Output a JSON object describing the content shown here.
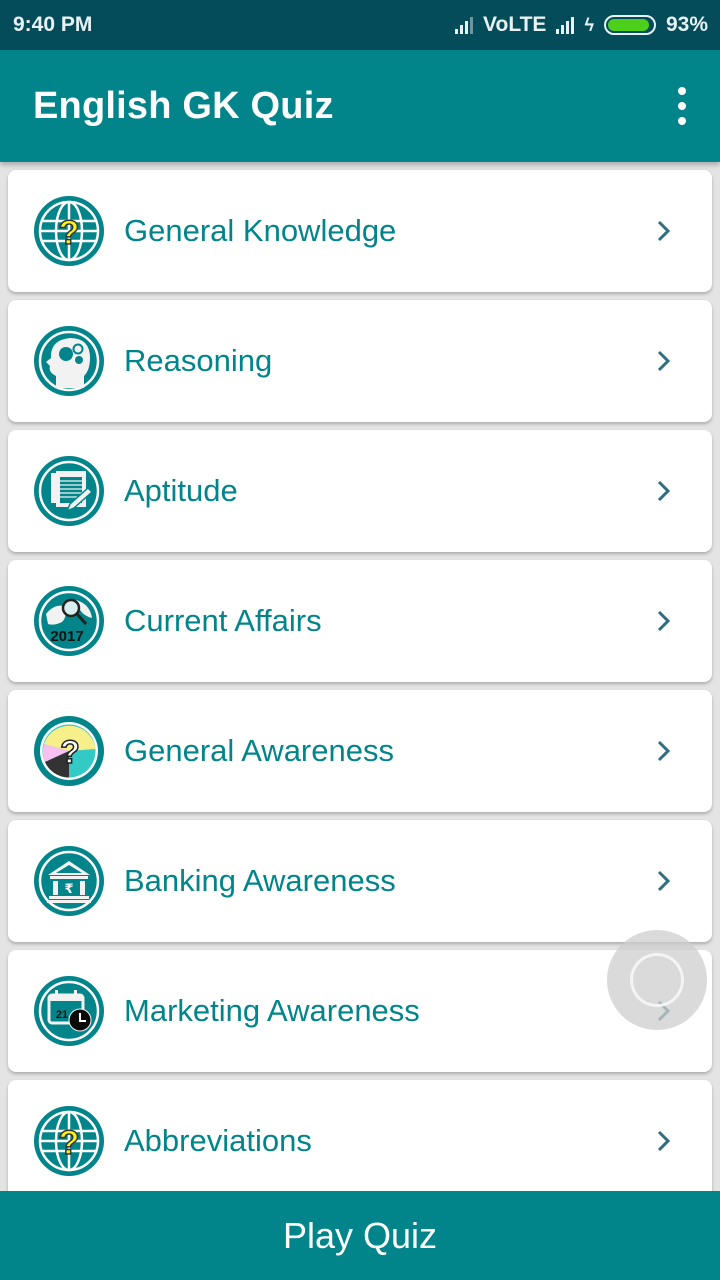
{
  "status_bar": {
    "time": "9:40 PM",
    "network_label": "VoLTE",
    "battery_percent_label": "93%",
    "battery_level": 0.93,
    "icons": [
      "signal-icon",
      "signal-icon",
      "charging-bolt-icon",
      "battery-icon"
    ]
  },
  "app_bar": {
    "title": "English GK Quiz",
    "menu_icon": "more-vert-icon"
  },
  "categories": [
    {
      "label": "General Knowledge",
      "icon": "globe-question-icon"
    },
    {
      "label": "Reasoning",
      "icon": "head-gears-icon"
    },
    {
      "label": "Aptitude",
      "icon": "notepad-pencil-icon"
    },
    {
      "label": "Current Affairs",
      "icon": "globe-magnifier-2017-icon",
      "icon_text": "2017"
    },
    {
      "label": "General Awareness",
      "icon": "pie-question-icon"
    },
    {
      "label": "Banking Awareness",
      "icon": "bank-rupee-icon"
    },
    {
      "label": "Marketing Awareness",
      "icon": "calendar-clock-icon",
      "icon_text": "21"
    },
    {
      "label": "Abbreviations",
      "icon": "globe-question-icon"
    }
  ],
  "bottom_bar": {
    "label": "Play Quiz"
  },
  "colors": {
    "primary": "#02858a",
    "status_bar": "#044c5a",
    "chevron": "#2f6d80",
    "battery": "#4cd01b"
  }
}
